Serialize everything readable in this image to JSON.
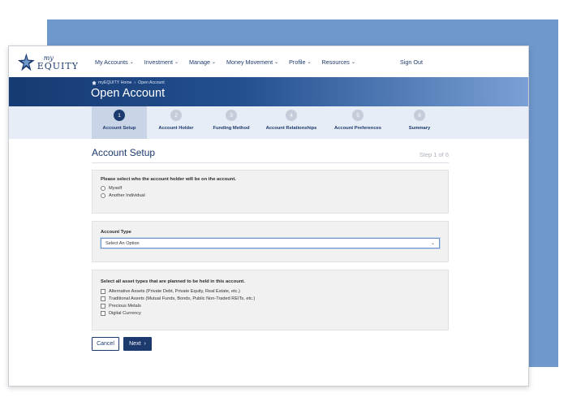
{
  "logo": {
    "my": "my",
    "brand": "EQUITY"
  },
  "nav": {
    "items": [
      {
        "label": "My Accounts"
      },
      {
        "label": "Investment"
      },
      {
        "label": "Manage"
      },
      {
        "label": "Money Movement"
      },
      {
        "label": "Profile"
      },
      {
        "label": "Resources"
      }
    ],
    "sign_out": "Sign Out"
  },
  "breadcrumb": {
    "home": "myEQUITY Home",
    "separator": "›",
    "current": "Open Account"
  },
  "page_title": "Open Account",
  "steps": [
    {
      "num": "1",
      "label": "Account Setup",
      "active": true
    },
    {
      "num": "2",
      "label": "Account Holder",
      "active": false
    },
    {
      "num": "3",
      "label": "Funding Method",
      "active": false
    },
    {
      "num": "4",
      "label": "Account Relationships",
      "active": false
    },
    {
      "num": "5",
      "label": "Account Preferences",
      "active": false
    },
    {
      "num": "6",
      "label": "Summary",
      "active": false
    }
  ],
  "section": {
    "title": "Account Setup",
    "step_indicator": "Step 1 of 6"
  },
  "holder_question": {
    "label": "Please select who the account holder will be on the account.",
    "options": [
      "Myself",
      "Another Individual"
    ]
  },
  "account_type": {
    "label": "Account Type",
    "selected": "Select An Option"
  },
  "asset_types": {
    "label": "Select all asset types that are planned to be held in this account.",
    "options": [
      "Alternative Assets (Private Debt, Private Equity, Real Estate, etc.)",
      "Traditional Assets (Mutual Funds, Bonds, Public Non-Traded REITs, etc.)",
      "Precious Metals",
      "Digital Currency"
    ]
  },
  "buttons": {
    "cancel": "Cancel",
    "next": "Next"
  },
  "colors": {
    "brand_navy": "#1d3a6e",
    "backdrop_blue": "#6f98cd",
    "steps_bg": "#e7edf6"
  }
}
